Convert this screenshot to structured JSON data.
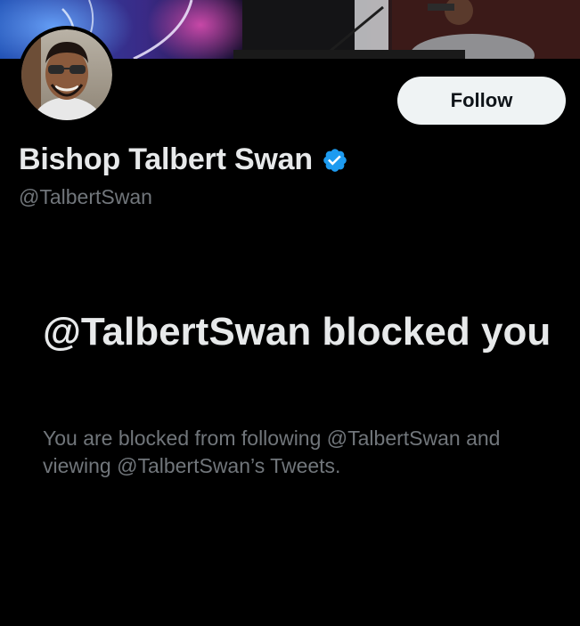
{
  "profile": {
    "display_name": "Bishop Talbert Swan",
    "handle": "@TalbertSwan",
    "verified": true,
    "verified_icon": "verified-badge-icon",
    "follow_label": "Follow"
  },
  "blocked": {
    "title": "@TalbertSwan blocked you",
    "description": "You are blocked from following @TalbertSwan and viewing @TalbertSwan’s Tweets."
  },
  "colors": {
    "background": "#000000",
    "primary_text": "#e7e9ea",
    "secondary_text": "#71767b",
    "verified_blue": "#1d9bf0",
    "follow_button_bg": "#eff3f4",
    "follow_button_text": "#0f1419"
  }
}
